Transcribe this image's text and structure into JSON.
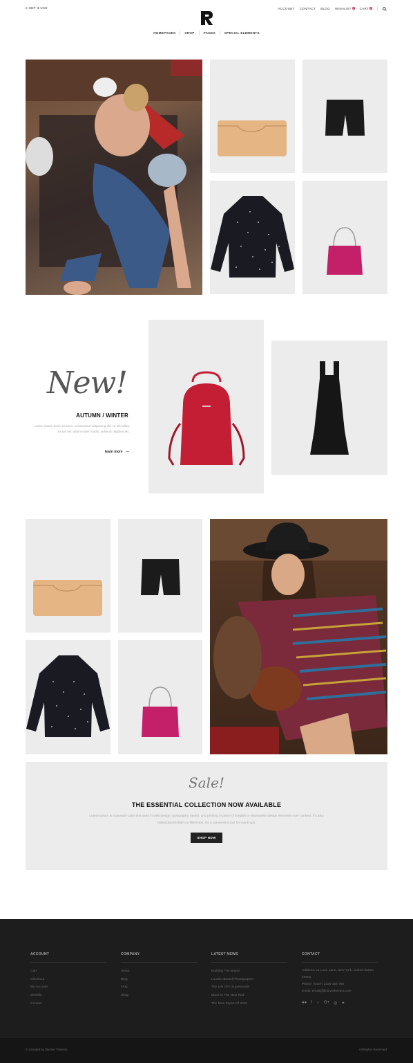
{
  "header": {
    "currency_gbp": "£ GBP",
    "currency_usd": "$ USD",
    "account": "ACCOUNT",
    "contact": "CONTACT",
    "blog": "BLOG",
    "wishlist": "WISHLIST",
    "wishlist_count": "0",
    "cart": "CART",
    "cart_count": "0",
    "search_icon": "search-icon",
    "logo_icon": "brand-logo-icon"
  },
  "nav": {
    "items": [
      "HOMEPAGES",
      "SHOP",
      "PAGES",
      "SPECIAL ELEMENTS"
    ]
  },
  "promo": {
    "script": "New!",
    "heading": "AUTUMN / WINTER",
    "body": "Lorem ipsum dolor sit amet, consectetur adipiscing elit. Ut elit tellus, luctus nec ullamcorper mattis, pulvinar dapibus leo.",
    "link": "learn more"
  },
  "sale": {
    "script": "Sale!",
    "title": "THE ESSENTIAL COLLECTION NOW AVAILABLE",
    "body": "Lorem Ipsum is a pseudo-Latin text used in web design, typography, layout, and printing in place of English to emphasise design elements over content. It's also called placeholder (or filler) text. It's a convenient tool for mock-ups.",
    "button": "SHOP NOW"
  },
  "footer": {
    "account": {
      "title": "ACCOUNT",
      "links": [
        "Cart",
        "Checkout",
        "My Account",
        "Wishlist",
        "Contact"
      ]
    },
    "company": {
      "title": "COMPANY",
      "links": [
        "About",
        "Blog",
        "FAQ",
        "Shop"
      ]
    },
    "news": {
      "title": "LATEST NEWS",
      "links": [
        "Building The Brand",
        "London Based Photographer",
        "The Life Of A Supermodel",
        "Black Is The New Red",
        "The New Styles Of 2015"
      ]
    },
    "contact": {
      "title": "CONTACT",
      "address": "Address: 21 Love Lane, New York, United States 10001",
      "phone": "Phone: (0427) 2325 456 789",
      "email": "Email: email@illusivethemes.com",
      "social_icons": [
        "flickr-icon",
        "facebook-icon",
        "dots-icon",
        "google-plus-icon",
        "instagram-icon",
        "twitter-icon"
      ]
    },
    "copyright": "© Created by Illusive Themes",
    "rights": "All Rights Reserved"
  },
  "colors": {
    "tile_bg": "#ececec",
    "footer_bg": "#1d1d1d",
    "badge": "#e0245e",
    "bag_red": "#c41e35",
    "bag_pink": "#c4206a"
  }
}
